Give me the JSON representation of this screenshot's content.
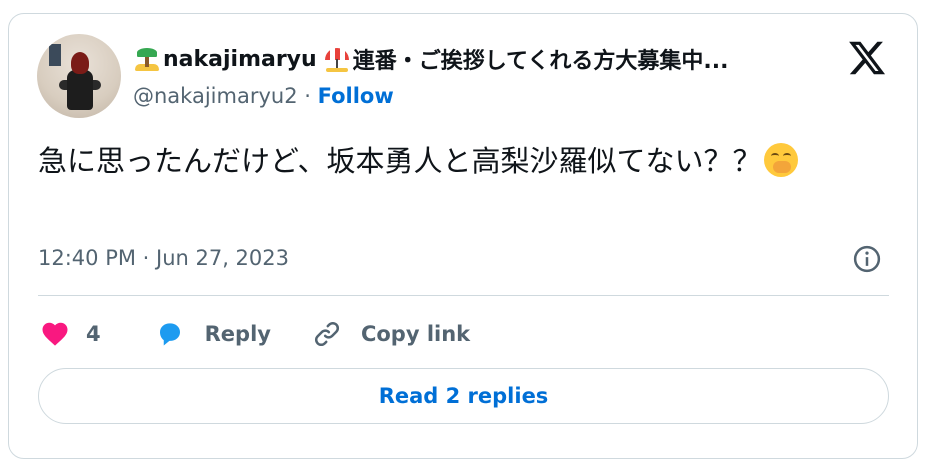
{
  "author": {
    "display_name": "nakajimaryu",
    "name_suffix": "連番・ご挨拶してくれる方大募集中...",
    "handle": "@nakajimaryu2",
    "separator": " · ",
    "follow_label": "Follow",
    "name_emojis": [
      "desert-island-icon",
      "beach-umbrella-icon"
    ]
  },
  "tweet": {
    "text": "急に思ったんだけど、坂本勇人と高梨沙羅似てない？？",
    "trailing_emoji": "face-with-hand-over-mouth-icon",
    "timestamp": "12:40 PM · Jun 27, 2023"
  },
  "actions": {
    "like_count": "4",
    "reply_label": "Reply",
    "copy_label": "Copy link"
  },
  "footer": {
    "read_replies_label": "Read 2 replies"
  },
  "colors": {
    "like": "#f91880",
    "reply": "#1d9bf0",
    "link": "#006fd6",
    "muted": "#536471",
    "border": "#cfd9de"
  }
}
